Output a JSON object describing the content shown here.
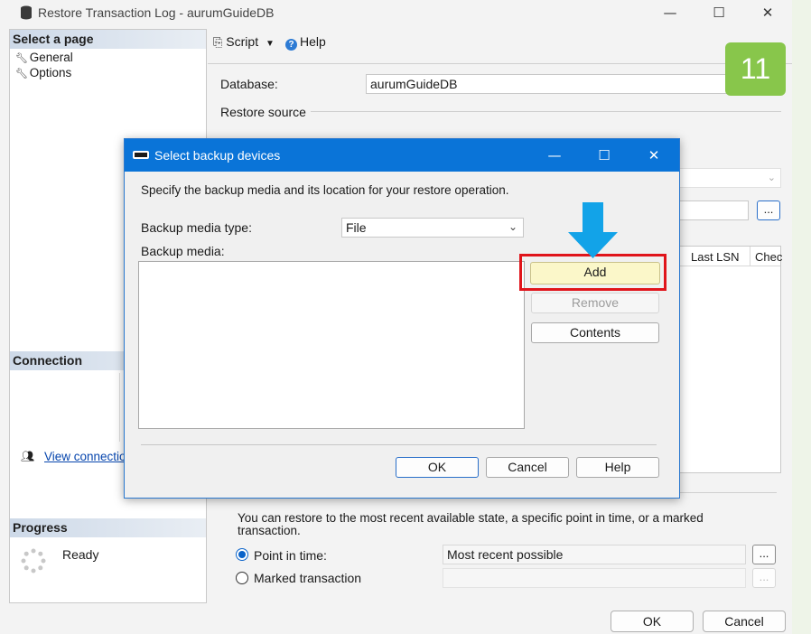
{
  "main": {
    "title": "Restore Transaction Log  -  aurumGuideDB",
    "window_controls": {
      "minimize": "—",
      "maximize": "☐",
      "close": "✕"
    },
    "left_pane": {
      "select_page_header": "Select a page",
      "pages": [
        {
          "label": "General"
        },
        {
          "label": "Options"
        }
      ],
      "connection_header": "Connection",
      "view_connection_link": "View connection properties",
      "progress_header": "Progress",
      "progress_status": "Ready"
    },
    "toolbar": {
      "script_label": "Script",
      "help_label": "Help"
    },
    "database_label": "Database:",
    "database_value": "aurumGuideDB",
    "restore_source_label": "Restore source",
    "browse_label": "...",
    "grid_headers": [
      "Last LSN",
      "Chec"
    ],
    "restore_to_text": "You can restore to the most recent available state, a specific point in time, or a marked transaction.",
    "point_in_time_label": "Point in time:",
    "point_in_time_value": "Most recent possible",
    "marked_transaction_label": "Marked transaction",
    "ok_label": "OK",
    "cancel_label": "Cancel"
  },
  "step_badge": "11",
  "dialog": {
    "title": "Select backup devices",
    "window_controls": {
      "minimize": "—",
      "maximize": "☐",
      "close": "✕"
    },
    "instruction": "Specify the backup media and its location for your restore operation.",
    "media_type_label": "Backup media type:",
    "media_type_value": "File",
    "backup_media_label": "Backup media:",
    "add_label": "Add",
    "remove_label": "Remove",
    "contents_label": "Contents",
    "ok_label": "OK",
    "cancel_label": "Cancel",
    "help_label": "Help"
  },
  "colors": {
    "dialog_titlebar": "#0a74d8",
    "highlight": "#e0141b",
    "arrow": "#12a3e8",
    "badge": "#88c64b",
    "add_button_bg": "#fbf7c9"
  }
}
